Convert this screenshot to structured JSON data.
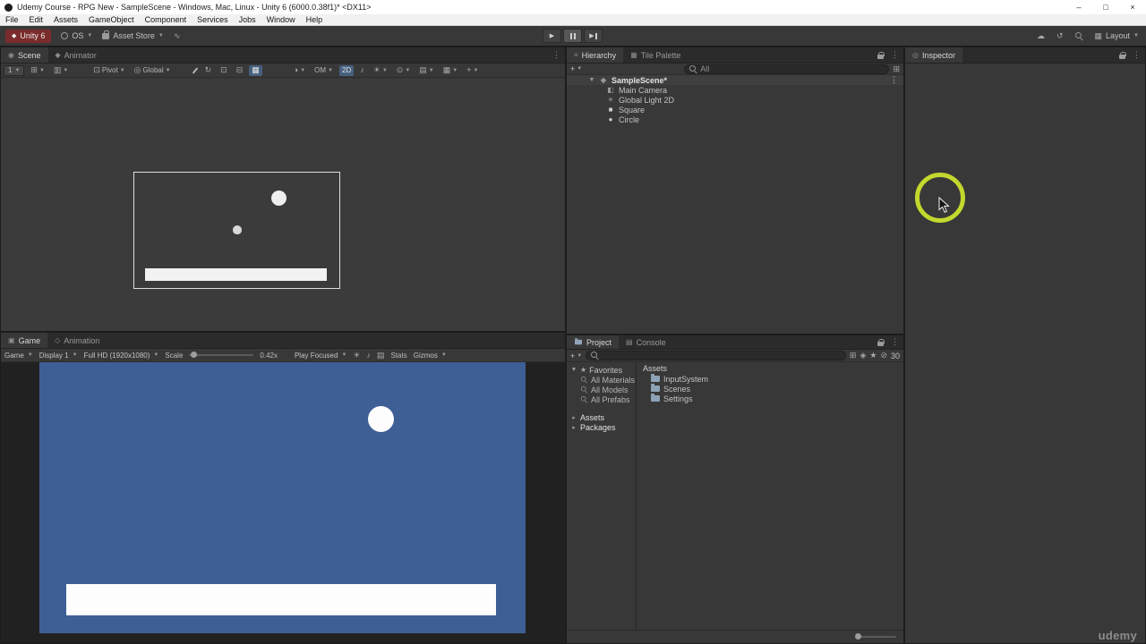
{
  "colors": {
    "unity_badge": "#7b2b2b",
    "game_background": "#3e5f96",
    "highlight_ring": "#c3d82d",
    "active_toggle": "#46607e"
  },
  "window": {
    "title": "Udemy Course - RPG New - SampleScene - Windows, Mac, Linux - Unity 6 (6000.0.38f1)* <DX11>",
    "minimize": "–",
    "maximize": "□",
    "close": "×"
  },
  "menu": {
    "items": [
      "File",
      "Edit",
      "Assets",
      "GameObject",
      "Component",
      "Services",
      "Jobs",
      "Window",
      "Help"
    ]
  },
  "toolbar": {
    "unity_version": "Unity 6",
    "account": "OS",
    "asset_store": "Asset Store",
    "layout": "Layout"
  },
  "scene_panel": {
    "tab_scene": "Scene",
    "tab_animator": "Animator",
    "toolbar": {
      "tool_value": "1",
      "pivot": "Pivot",
      "orientation": "Global",
      "draw_mode": "OM",
      "mode_2d": "2D"
    }
  },
  "hierarchy_panel": {
    "tab_hierarchy": "Hierarchy",
    "tab_tile_palette": "Tile Palette",
    "search_placeholder": "All",
    "scene_name": "SampleScene*",
    "items": [
      {
        "label": "Main Camera"
      },
      {
        "label": "Global Light 2D"
      },
      {
        "label": "Square"
      },
      {
        "label": "Circle"
      }
    ]
  },
  "inspector_panel": {
    "tab": "Inspector"
  },
  "game_panel": {
    "tab_game": "Game",
    "tab_animation": "Animation",
    "toolbar": {
      "view": "Game",
      "display": "Display 1",
      "resolution": "Full HD (1920x1080)",
      "scale_label": "Scale",
      "scale_value": "0.42x",
      "focus_mode": "Play Focused",
      "stats": "Stats",
      "gizmos": "Gizmos"
    }
  },
  "project_panel": {
    "tab_project": "Project",
    "tab_console": "Console",
    "favorites_label": "Favorites",
    "favorites": [
      {
        "label": "All Materials"
      },
      {
        "label": "All Models"
      },
      {
        "label": "All Prefabs"
      }
    ],
    "roots": [
      {
        "label": "Assets"
      },
      {
        "label": "Packages"
      }
    ],
    "breadcrumb": "Assets",
    "folders": [
      {
        "label": "InputSystem"
      },
      {
        "label": "Scenes"
      },
      {
        "label": "Settings"
      }
    ],
    "hidden_count": "30"
  },
  "watermark": "udemy"
}
